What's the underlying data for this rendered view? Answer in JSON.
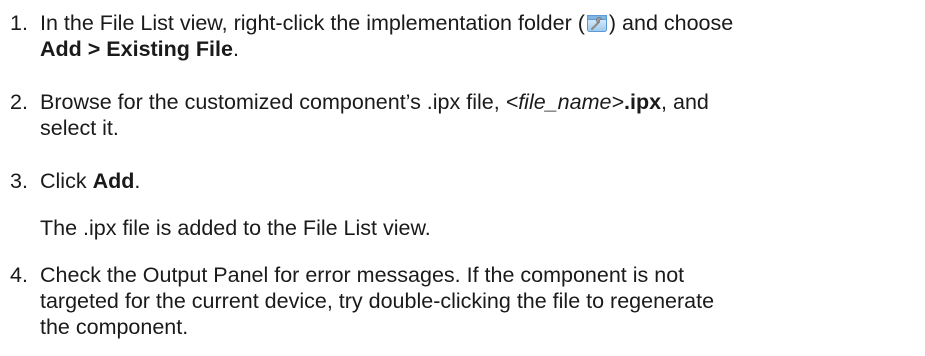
{
  "steps": [
    {
      "number": "1.",
      "line1_before_icon": "In the File List view, right-click the implementation folder (",
      "icon": "implementation-folder-icon",
      "line1_after_icon": ") and choose",
      "line2_bold": "Add > Existing File",
      "line2_after": "."
    },
    {
      "number": "2.",
      "line1_before": "Browse for the customized component’s .ipx file, ",
      "filename_italic": "<file_name>",
      "ext_bold": ".ipx",
      "line1_after": ", and",
      "line2": "select it."
    },
    {
      "number": "3.",
      "line1_before": "Click ",
      "line1_bold": "Add",
      "line1_after": ".",
      "result": "The .ipx file is added to the File List view."
    },
    {
      "number": "4.",
      "line1": "Check the Output Panel for error messages. If the component is not",
      "line2": "targeted for the current device, try double-clicking the file to regenerate",
      "line3": "the component."
    }
  ]
}
